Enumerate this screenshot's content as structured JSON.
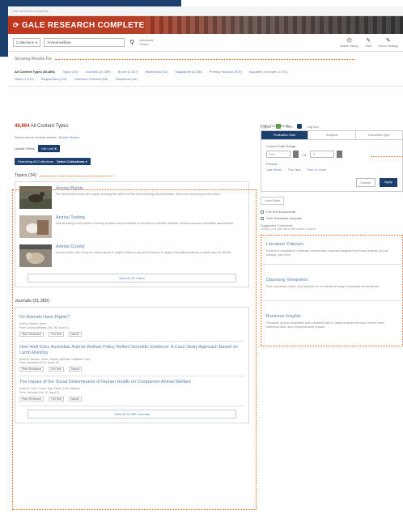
{
  "utility": {
    "breadcrumb": "Gale Research Complete",
    "profile_label": "English",
    "help_label": "Help",
    "logout_label": "Log Out"
  },
  "brand": {
    "logo_text": "GALE RESEARCH COMPLETE"
  },
  "searchbar": {
    "collection_select": "Collections",
    "search_value": "Animal welfare",
    "advanced_label": "Advanced Search",
    "tools": [
      {
        "icon": "bookmark-icon",
        "label": "Search History"
      },
      {
        "icon": "pencil-icon",
        "label": "Tools"
      },
      {
        "icon": "settings-icon",
        "label": "Search Settings"
      }
    ]
  },
  "showing": {
    "heading": "Showing Results For",
    "filters": [
      "All Content Types (46,894)",
      "Topics (34)",
      "Journals (31,389)",
      "Books (4,527)",
      "Multimedia (92)",
      "Magazines (5,186)",
      "Primary Sources (519)",
      "Academic Journals (2,743)",
      "News (1,617)",
      "Biographies (123)",
      "Literature Criticism (68)",
      "Viewpoints (24)"
    ]
  },
  "results": {
    "count_number": "46,894",
    "count_label": "All Content Types",
    "terms_prefix": "Search terms:",
    "terms_value": "Animal welfare",
    "revise_label": "Revise Search",
    "update_label": "Update Filters",
    "get_link_label": "Get Link",
    "search_in_label": "Searching All Collections",
    "select_collections_label": "Select Collections"
  },
  "topics": {
    "title": "Topics (34)",
    "items": [
      {
        "title": "Animal Rights",
        "desc": "The belief that animals have rights, including the right to be free from suffering and exploitation, and to live according to their nature."
      },
      {
        "title": "Animal Testing",
        "desc": "Animal testing is the practice of testing products and procedures on animals for scientific research, medical purposes and safety assessments."
      },
      {
        "title": "Animal Cruelty",
        "desc": "Animal cruelty, also known as animal abuse or neglect, refers to any act of violence or neglect that inflicts suffering or death upon an animal."
      }
    ],
    "view_all_label": "View All 34 Topics"
  },
  "journals": {
    "title": "Journals (31,389)",
    "items": [
      {
        "title": "Do Animals Have Rights?",
        "author": "Author: Becker, Anne",
        "source": "From: Animal Welfare (Vol. 25, Issue 1)",
        "tags": [
          "Peer-Reviewed",
          "Full Text",
          "Article"
        ]
      },
      {
        "title": "How Well Does Australian Animal Welfare Policy Reflect Scientific Evidence: A Case Study Approach Based on Lamb Marking",
        "author": "Authors: Morton, Clare, Hebart, Michelle, Whittaker, Alex",
        "source": "From: Animals (Vol. 8, Issue 11)",
        "tags": [
          "Peer-Reviewed",
          "Full Text",
          "Report"
        ]
      },
      {
        "title": "The Impact of the Social Determinants of Human Health on Companion Animal Welfare",
        "author": "Authors: Card, Claire, Epp, Tasha, Lem, Melissa",
        "source": "From: Animals (Vol. 11, Issue 5)",
        "tags": [
          "Peer-Reviewed",
          "Full Text",
          "Article"
        ]
      }
    ],
    "view_all_label": "View All 31,389 Journals"
  },
  "sidebar": {
    "filter_title": "Filter Your Results",
    "tabs": [
      "Publication Date",
      "Subjects",
      "Document Type"
    ],
    "date_range_label": "Custom Date Range",
    "date_from": "From",
    "date_to": "To",
    "presets_label": "Presets",
    "presets": [
      "Last Month",
      "This Year",
      "Past 10 Years"
    ],
    "cancel_label": "Cancel",
    "apply_label": "Apply",
    "learn_more_label": "Learn More",
    "checkbox_full_text": "Full Text Documents",
    "checkbox_peer": "Peer-Reviewed Journals",
    "suggested_title": "Suggested Collections",
    "suggested_sub": "Search your collections with related content",
    "collections": [
      {
        "title": "Literature Criticism",
        "desc": "Explore a compilation of literary commentary, includes analysis from book reviews, journal essays, and more."
      },
      {
        "title": "Opposing Viewpoints",
        "desc": "Find overviews, news, and opinions on hundreds of today's important social issues."
      },
      {
        "title": "Business Insights",
        "desc": "Research global companies and industries with in-depth analysis through current news, statistical data, and comprehensive reports."
      }
    ]
  },
  "colors": {
    "brand_navy": "#1c3f6e",
    "brand_red": "#c0361d",
    "link_blue": "#5a7fb0",
    "callout_orange": "#e06a2c"
  }
}
